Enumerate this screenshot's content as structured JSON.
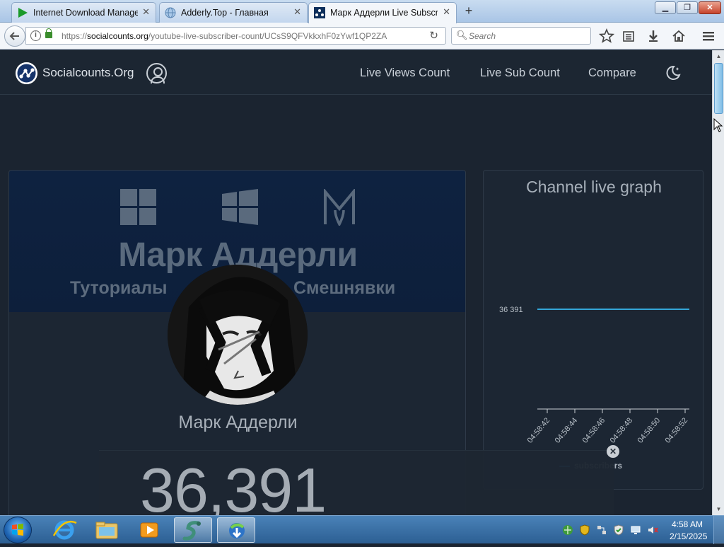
{
  "browser": {
    "tabs": [
      {
        "label": "Internet Download Manager",
        "active": false
      },
      {
        "label": "Adderly.Top - Главная",
        "active": false
      },
      {
        "label": "Марк Аддерли Live Subscriber",
        "active": true
      }
    ],
    "tab_close_glyph": "✕",
    "new_tab_glyph": "+",
    "window_controls": {
      "minimize": "▁",
      "maximize": "❐",
      "close": "✕"
    },
    "url_prefix": "https://",
    "url_domain": "socialcounts.org",
    "url_path": "/youtube-live-subscriber-count/UCsS9QFVkkxhF0zYwf1QP2ZA",
    "search_placeholder": "Search",
    "toolbar_icons": [
      "star-icon",
      "reading-list-icon",
      "download-icon",
      "home-icon",
      "menu-icon"
    ]
  },
  "site": {
    "name": "Socialcounts.Org",
    "nav": [
      "Live Views Count",
      "Live Sub Count",
      "Compare"
    ]
  },
  "profile": {
    "banner_title": "Марк Аддерли",
    "banner_left": "Туториалы",
    "banner_right": "Смешнявки",
    "channel_name": "Марк Аддерли",
    "subscriber_count": "36,391"
  },
  "overlay": {
    "close_glyph": "✕"
  },
  "graph": {
    "title": "Channel live graph",
    "close_glyph": "✕"
  },
  "chart_data": {
    "type": "line",
    "title": "Channel live graph",
    "x": [
      "04:58:42",
      "04:58:44",
      "04:58:46",
      "04:58:48",
      "04:58:50",
      "04:58:52"
    ],
    "series": [
      {
        "name": "subscribers",
        "values": [
          36391,
          36391,
          36391,
          36391,
          36391,
          36391
        ]
      }
    ],
    "y_tick_labels": [
      "36 391"
    ],
    "legend_position": "bottom",
    "colors": {
      "line": "#34a6d8"
    }
  },
  "taskbar": {
    "clock_time": "4:58 AM",
    "clock_date": "2/15/2025",
    "apps": [
      "internet-explorer-icon",
      "file-explorer-icon",
      "media-player-icon",
      "snake-app-icon",
      "idm-icon"
    ]
  },
  "colors": {
    "page_bg": "#1b2430",
    "card_bg": "#1c2633",
    "accent_line": "#34a6d8"
  }
}
